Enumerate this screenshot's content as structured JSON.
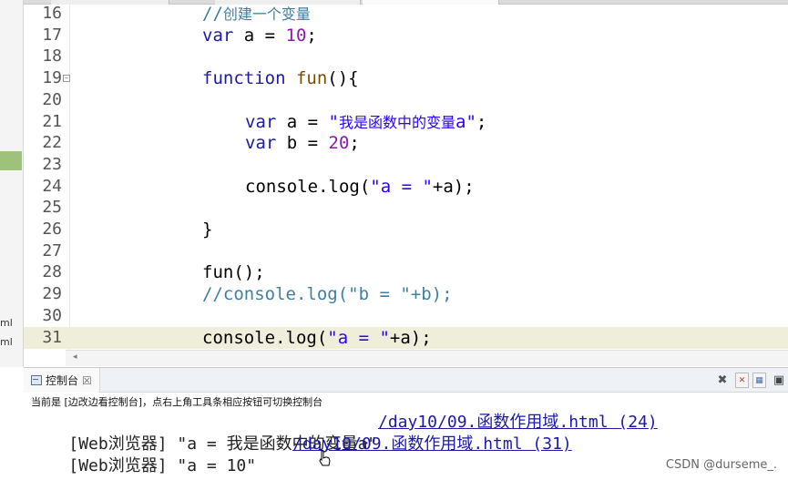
{
  "left_panel": {
    "fragments": [
      "ml",
      "ml"
    ]
  },
  "editor": {
    "lines": [
      {
        "n": "16",
        "code": [
          {
            "t": "//",
            "c": "cmt"
          },
          {
            "t": "创建一个变量",
            "c": "cmt cjk"
          }
        ]
      },
      {
        "n": "17",
        "code": [
          {
            "t": "var",
            "c": "kw"
          },
          {
            "t": " a = ",
            "c": ""
          },
          {
            "t": "10",
            "c": "num"
          },
          {
            "t": ";",
            "c": ""
          }
        ]
      },
      {
        "n": "18",
        "code": []
      },
      {
        "n": "19",
        "fold": "−",
        "code": [
          {
            "t": "function",
            "c": "kw"
          },
          {
            "t": " ",
            "c": ""
          },
          {
            "t": "fun",
            "c": "fn"
          },
          {
            "t": "(){",
            "c": ""
          }
        ]
      },
      {
        "n": "20",
        "code": []
      },
      {
        "n": "21",
        "indent": 2,
        "code": [
          {
            "t": "var",
            "c": "kw"
          },
          {
            "t": " a = ",
            "c": ""
          },
          {
            "t": "\"",
            "c": "str"
          },
          {
            "t": "我是函数中的变量",
            "c": "str cjk"
          },
          {
            "t": "a\"",
            "c": "str"
          },
          {
            "t": ";",
            "c": ""
          }
        ]
      },
      {
        "n": "22",
        "indent": 2,
        "code": [
          {
            "t": "var",
            "c": "kw"
          },
          {
            "t": " b = ",
            "c": ""
          },
          {
            "t": "20",
            "c": "num"
          },
          {
            "t": ";",
            "c": ""
          }
        ]
      },
      {
        "n": "23",
        "code": []
      },
      {
        "n": "24",
        "indent": 2,
        "code": [
          {
            "t": "console.log(",
            "c": ""
          },
          {
            "t": "\"a = \"",
            "c": "str"
          },
          {
            "t": "+a);",
            "c": ""
          }
        ]
      },
      {
        "n": "25",
        "code": []
      },
      {
        "n": "26",
        "code": [
          {
            "t": "}",
            "c": ""
          }
        ]
      },
      {
        "n": "27",
        "code": []
      },
      {
        "n": "28",
        "code": [
          {
            "t": "fun();",
            "c": ""
          }
        ]
      },
      {
        "n": "29",
        "code": [
          {
            "t": "//console.log(\"b = \"+b);",
            "c": "cmt"
          }
        ]
      },
      {
        "n": "30",
        "code": []
      },
      {
        "n": "31",
        "current": true,
        "code": [
          {
            "t": "console.log(",
            "c": ""
          },
          {
            "t": "\"a = \"",
            "c": "str"
          },
          {
            "t": "+a);",
            "c": ""
          }
        ]
      }
    ]
  },
  "console": {
    "tab_label": "控制台",
    "tab_close": "☒",
    "status": "当前是 [边改边看控制台]，点右上角工具条相应按钮可切换控制台",
    "toolbar": {
      "clear": "✖",
      "icons": [
        "copy-icon",
        "pin-icon",
        "display-icon"
      ]
    },
    "output": [
      {
        "text": "[Web浏览器] \"a = 我是函数中的变量a\"",
        "link": "/day10/09.函数作用域.html (24)"
      },
      {
        "text": "[Web浏览器] \"a = 10\"",
        "link": "/day10/09.函数作用域.html (31)"
      }
    ]
  },
  "watermark": "CSDN @durseme_."
}
